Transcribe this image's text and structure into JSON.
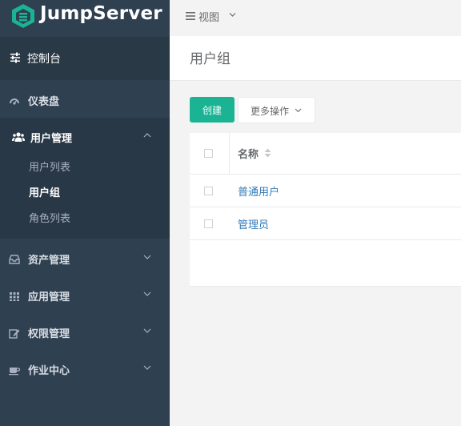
{
  "app": {
    "brand": "JumpServer"
  },
  "colors": {
    "sidebar": "#2f4050",
    "accent": "#1ab394",
    "link": "#337ab7"
  },
  "sidebar": {
    "console": {
      "label": "控制台",
      "icon": "sliders-icon"
    },
    "items": [
      {
        "label": "仪表盘",
        "icon": "dashboard-icon"
      },
      {
        "label": "用户管理",
        "icon": "users-icon",
        "expanded": true,
        "children": [
          {
            "label": "用户列表"
          },
          {
            "label": "用户组",
            "active": true
          },
          {
            "label": "角色列表"
          }
        ]
      },
      {
        "label": "资产管理",
        "icon": "inbox-icon"
      },
      {
        "label": "应用管理",
        "icon": "grid-icon"
      },
      {
        "label": "权限管理",
        "icon": "edit-icon"
      },
      {
        "label": "作业中心",
        "icon": "coffee-icon"
      }
    ]
  },
  "topbar": {
    "view_label": "视图"
  },
  "page": {
    "title": "用户组"
  },
  "toolbar": {
    "create_label": "创建",
    "more_label": "更多操作"
  },
  "table": {
    "columns": [
      {
        "label": "名称"
      }
    ],
    "rows": [
      {
        "name": "普通用户"
      },
      {
        "name": "管理员"
      }
    ]
  }
}
